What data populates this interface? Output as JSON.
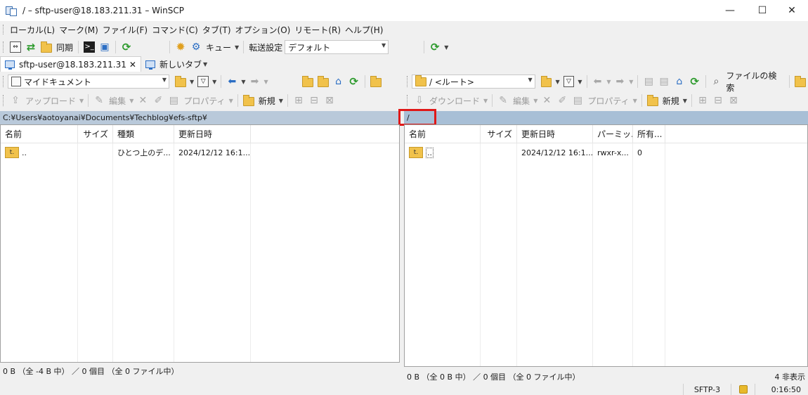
{
  "window": {
    "title": "/ – sftp-user@18.183.211.31 – WinSCP"
  },
  "menu": [
    "ローカル(L)",
    "マーク(M)",
    "ファイル(F)",
    "コマンド(C)",
    "タブ(T)",
    "オプション(O)",
    "リモート(R)",
    "ヘルプ(H)"
  ],
  "toolbar": {
    "sync_label": "同期",
    "queue_label": "キュー",
    "transfer_settings_label": "転送設定",
    "transfer_preset": "デフォルト"
  },
  "tabs": [
    {
      "label": "sftp-user@18.183.211.31",
      "close": "✕"
    },
    {
      "label": "新しいタブ"
    }
  ],
  "left": {
    "location": "マイドキュメント",
    "upload_label": "アップロード",
    "edit_label": "編集",
    "properties_label": "プロパティ",
    "new_label": "新規",
    "path": "C:¥Users¥aotoyanai¥Documents¥Techblog¥efs-sftp¥",
    "columns": [
      "名前",
      "サイズ",
      "種類",
      "更新日時"
    ],
    "rows": [
      {
        "name": "..",
        "size": "",
        "type": "ひとつ上のデ...",
        "modified": "2024/12/12 16:1..."
      }
    ],
    "status": "0 B （全 -4 B 中） ／ 0 個目 （全 0 ファイル中）"
  },
  "right": {
    "location": "/ <ルート>",
    "search_label": "ファイルの検索",
    "download_label": "ダウンロード",
    "edit_label": "編集",
    "properties_label": "プロパティ",
    "new_label": "新規",
    "path": "/",
    "columns": [
      "名前",
      "サイズ",
      "更新日時",
      "パーミッ...",
      "所有..."
    ],
    "rows": [
      {
        "name": "..",
        "size": "",
        "modified": "2024/12/12 16:1...",
        "permissions": "rwxr-x...",
        "owner": "0"
      }
    ],
    "status": "0 B （全 0 B 中） ／ 0 個目 （全 0 ファイル中）",
    "hidden": "4 非表示"
  },
  "statusbar": {
    "protocol": "SFTP-3",
    "time": "0:16:50"
  },
  "colors": {
    "path_bar": "#a8bfd6",
    "highlight": "#e01818",
    "folder": "#f1c24b"
  }
}
